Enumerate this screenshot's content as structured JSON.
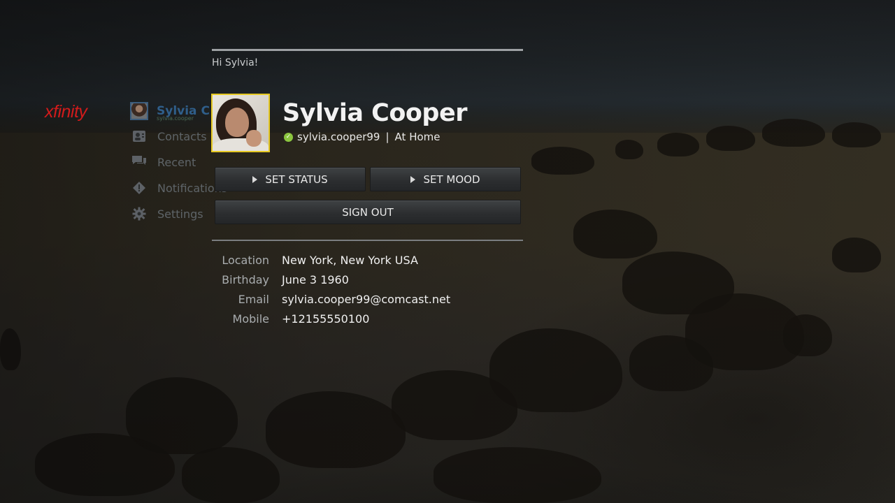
{
  "brand": {
    "logo_text": "xfinity",
    "logo_color": "#d11b1b"
  },
  "nav": {
    "user": {
      "name": "Sylvia C",
      "sub": "sylvia.cooper"
    },
    "items": [
      {
        "label": "Contacts",
        "icon": "contacts-icon"
      },
      {
        "label": "Recent",
        "icon": "chat-icon"
      },
      {
        "label": "Notifications",
        "icon": "alert-icon"
      },
      {
        "label": "Settings",
        "icon": "gear-icon"
      }
    ]
  },
  "profile": {
    "greeting": "Hi Sylvia!",
    "name": "Sylvia Cooper",
    "username": "sylvia.cooper99",
    "separator": "|",
    "status": "At Home",
    "presence_color": "#8bc53f",
    "photo_border_color": "#e6c923"
  },
  "actions": {
    "set_status": "SET STATUS",
    "set_mood": "SET MOOD",
    "sign_out": "SIGN OUT"
  },
  "details": [
    {
      "label": "Location",
      "value": "New York, New York USA"
    },
    {
      "label": "Birthday",
      "value": "June 3 1960"
    },
    {
      "label": "Email",
      "value": "sylvia.cooper99@comcast.net"
    },
    {
      "label": "Mobile",
      "value": "+12155550100"
    }
  ]
}
